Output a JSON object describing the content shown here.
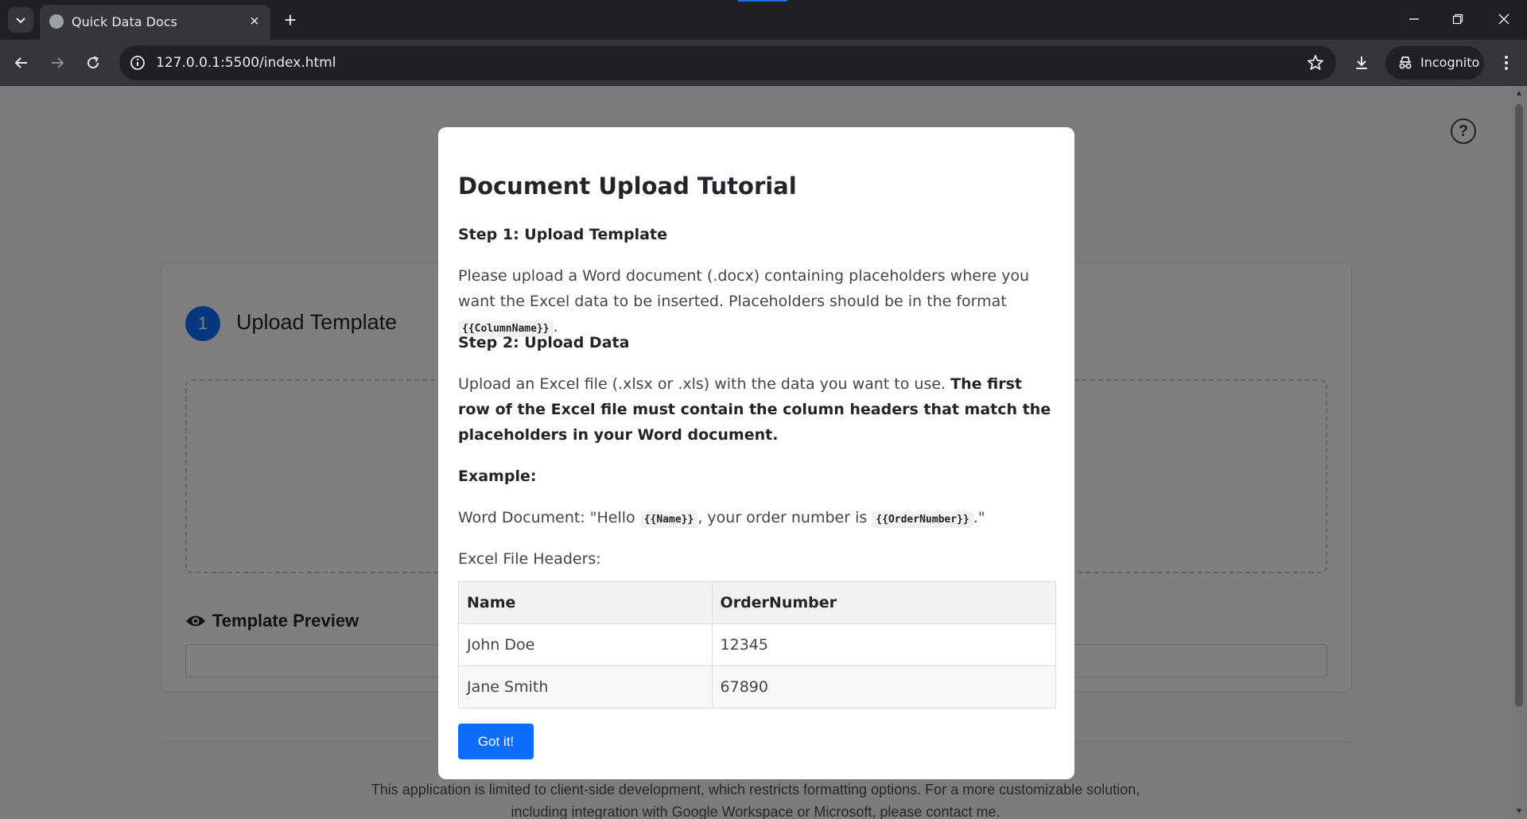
{
  "browser": {
    "tab_title": "Quick Data Docs",
    "url": "127.0.0.1:5500/index.html",
    "profile_label": "Incognito"
  },
  "page": {
    "step_number": "1",
    "step_title": "Upload Template",
    "preview_heading": "Template Preview",
    "help_label": "?",
    "footer_line1": "This application is limited to client-side development, which restricts formatting options. For a more customizable solution,",
    "footer_line2": "including integration with Google Workspace or Microsoft, please contact me."
  },
  "modal": {
    "title": "Document Upload Tutorial",
    "step1_heading": "Step 1: Upload Template",
    "step1_text": "Please upload a Word document (.docx) containing placeholders where you want the Excel data to be inserted. Placeholders should be in the format",
    "step1_code": "{{ColumnName}}",
    "step1_end": ".",
    "step2_heading": "Step 2: Upload Data",
    "step2_text": "Upload an Excel file (.xlsx or .xls) with the data you want to use.",
    "step2_bold": "The first row of the Excel file must contain the column headers that match the placeholders in your Word document.",
    "example_heading": "Example:",
    "example_prefix": "Word Document: \"Hello",
    "example_code1": "{{Name}}",
    "example_middle": ", your order number is",
    "example_code2": "{{OrderNumber}}",
    "example_suffix": ".\"",
    "headers_label": "Excel File Headers:",
    "table": {
      "headers": [
        "Name",
        "OrderNumber"
      ],
      "rows": [
        [
          "John Doe",
          "12345"
        ],
        [
          "Jane Smith",
          "67890"
        ]
      ]
    },
    "button_label": "Got it!"
  },
  "colors": {
    "primary": "#0d6efd",
    "chrome_dark": "#1f2023",
    "chrome_toolbar": "#35363a"
  }
}
